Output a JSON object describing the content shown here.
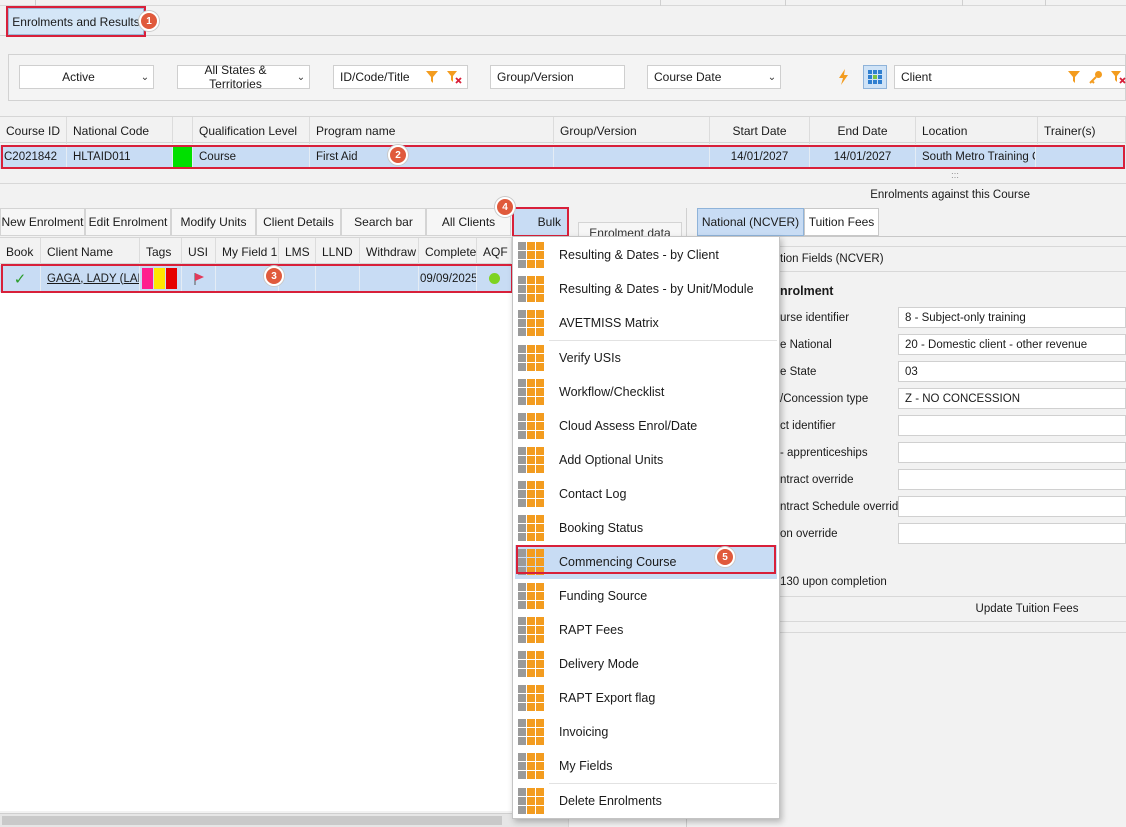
{
  "tabs": {
    "active_label": "Enrolments and Results"
  },
  "filters": {
    "status": "Active",
    "states": "All States & Territories",
    "id_search_placeholder": "ID/Code/Title",
    "group_placeholder": "Group/Version",
    "date_type": "Course Date",
    "client_placeholder": "Client"
  },
  "course_grid": {
    "columns": [
      "Course ID",
      "National Code",
      "",
      "Qualification Level",
      "Program name",
      "Group/Version",
      "Start Date",
      "End Date",
      "Location",
      "Trainer(s)"
    ],
    "row": {
      "course_id": "C2021842",
      "national_code": "HLTAID011",
      "color": "#00e000",
      "qualification_level": "Course",
      "program_name": "First Aid",
      "group_version": "",
      "start_date": "14/01/2027",
      "end_date": "14/01/2027",
      "location": "South Metro Training C",
      "trainers": ""
    }
  },
  "enrolments_caption": "Enrolments against this Course",
  "enrolment_toolbar": {
    "new": "New Enrolment",
    "edit": "Edit Enrolment",
    "modify": "Modify Units",
    "client_details": "Client Details",
    "search_bar": "Search bar",
    "all_clients": "All Clients",
    "bulk": "Bulk",
    "enrolment_data": "Enrolment data"
  },
  "enrolment_grid": {
    "columns": [
      "Book",
      "Client Name",
      "Tags",
      "USI",
      "My Field 1",
      "LMS",
      "LLND",
      "Withdraw",
      "Complete",
      "AQF"
    ],
    "row": {
      "client_name": "GAGA, LADY (LAD",
      "complete": "09/09/2025",
      "status_color": "#7ed321"
    },
    "tag_colors": [
      "#ff1f8e",
      "#ffe600",
      "#e60000"
    ]
  },
  "bulk_menu": {
    "items": [
      "Resulting & Dates - by Client",
      "Resulting & Dates - by Unit/Module",
      "AVETMISS Matrix",
      "Verify USIs",
      "Workflow/Checklist",
      "Cloud Assess Enrol/Date",
      "Add Optional Units",
      "Contact Log",
      "Booking Status",
      "Commencing Course",
      "Funding Source",
      "RAPT Fees",
      "Delivery Mode",
      "RAPT Export flag",
      "Invoicing",
      "My Fields",
      "Delete Enrolments"
    ],
    "highlighted": "Commencing Course"
  },
  "right_panel": {
    "tab_national": "National (NCVER)",
    "tab_tuition": "Tuition Fees",
    "section_header": "tion Fields (NCVER)",
    "section_title": "nrolment",
    "fields": [
      {
        "label": "urse identifier",
        "value": "8 - Subject-only training"
      },
      {
        "label": "e National",
        "value": "20 - Domestic client - other revenue"
      },
      {
        "label": "e State",
        "value": "03"
      },
      {
        "label": "/Concession type",
        "value": "Z - NO CONCESSION"
      },
      {
        "label": "ct identifier",
        "value": ""
      },
      {
        "label": "- apprenticeships",
        "value": ""
      },
      {
        "label": "ntract override",
        "value": ""
      },
      {
        "label": "ntract Schedule override",
        "value": ""
      },
      {
        "label": "on override",
        "value": ""
      }
    ],
    "completion_note": "130 upon completion",
    "update_button": "Update Tuition Fees"
  },
  "annotations": [
    "1",
    "2",
    "3",
    "4",
    "5"
  ],
  "colors": {
    "selection": "#c8dcf4",
    "accent_red": "#d8203a",
    "badge": "#e05a3c",
    "menu_icon": "#f39c1f"
  }
}
